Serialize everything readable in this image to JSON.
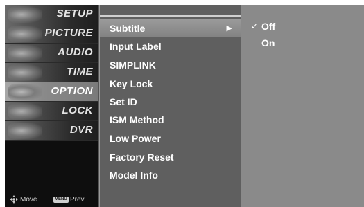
{
  "categories": [
    {
      "label": "SETUP",
      "icon": "setup-satellite-icon"
    },
    {
      "label": "PICTURE",
      "icon": "picture-film-icon"
    },
    {
      "label": "AUDIO",
      "icon": "audio-speaker-icon"
    },
    {
      "label": "TIME",
      "icon": "time-clock-icon"
    },
    {
      "label": "OPTION",
      "icon": "option-stamp-icon",
      "selected": true
    },
    {
      "label": "LOCK",
      "icon": "lock-icon"
    },
    {
      "label": "DVR",
      "icon": "dvr-disc-icon"
    }
  ],
  "footer": {
    "move_label": "Move",
    "menu_key": "MENU",
    "prev_label": "Prev"
  },
  "submenu": {
    "items": [
      {
        "label": "Subtitle",
        "selected": true
      },
      {
        "label": "Input Label"
      },
      {
        "label": "SIMPLINK"
      },
      {
        "label": "Key Lock"
      },
      {
        "label": "Set ID"
      },
      {
        "label": "ISM Method"
      },
      {
        "label": "Low Power"
      },
      {
        "label": "Factory Reset"
      },
      {
        "label": "Model Info"
      }
    ],
    "arrow_glyph": "▶"
  },
  "options": {
    "check_glyph": "✓",
    "items": [
      {
        "label": "Off",
        "checked": true
      },
      {
        "label": "On",
        "checked": false
      }
    ]
  }
}
